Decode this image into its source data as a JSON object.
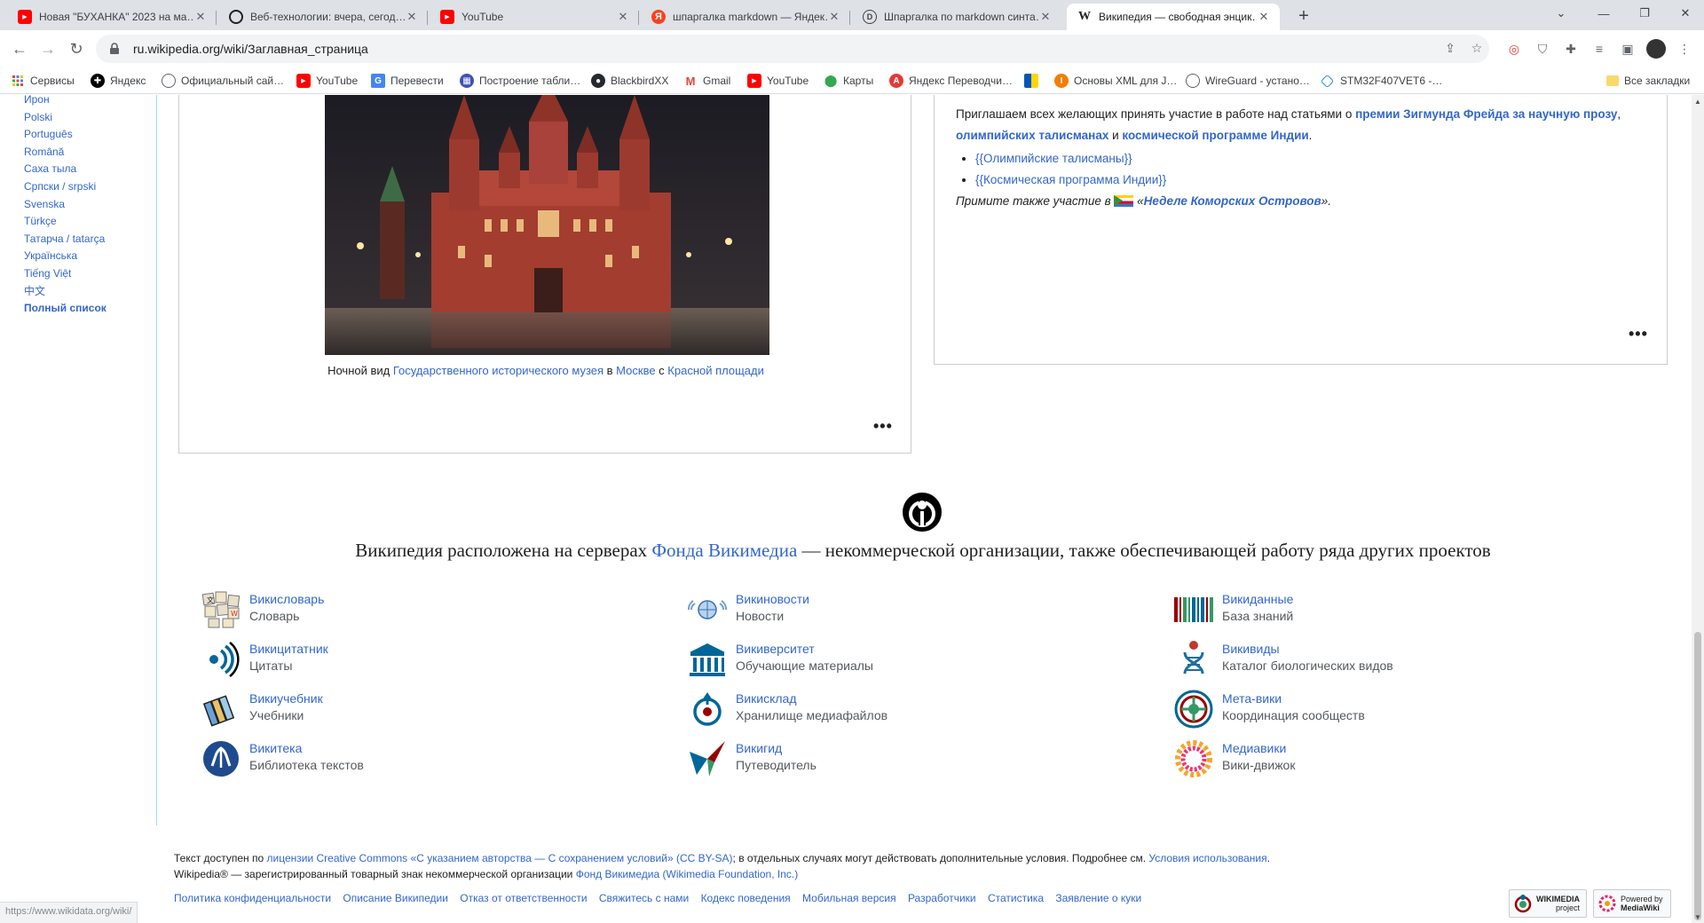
{
  "browser": {
    "tabs": [
      {
        "title": "Новая \"БУХАНКА\" 2023 на ма…",
        "favicon": "youtube-icon",
        "color": "#ff0000"
      },
      {
        "title": "Веб-технологии: вчера, сегод…",
        "favicon": "openai-icon",
        "color": "#202124"
      },
      {
        "title": "YouTube",
        "favicon": "youtube-icon",
        "color": "#ff0000"
      },
      {
        "title": "шпаргалка markdown — Яндек…",
        "favicon": "yandex-icon",
        "color": "#fc3f1d"
      },
      {
        "title": "Шпаргалка по markdown синта…",
        "favicon": "document-icon",
        "color": "#3c4043"
      },
      {
        "title": "Википедия — свободная энцик…",
        "favicon": "wikipedia-icon",
        "color": "#202124"
      }
    ],
    "url": "ru.wikipedia.org/wiki/Заглавная_страница",
    "bookmarks": [
      {
        "label": "Сервисы",
        "icon": "apps-grid-icon"
      },
      {
        "label": "Яндекс",
        "icon": "yandex-icon"
      },
      {
        "label": "Официальный сай…",
        "icon": "globe-icon"
      },
      {
        "label": "YouTube",
        "icon": "youtube-icon"
      },
      {
        "label": "Перевести",
        "icon": "translate-icon"
      },
      {
        "label": "Построение табли…",
        "icon": "table-icon"
      },
      {
        "label": "BlackbirdXX",
        "icon": "github-icon"
      },
      {
        "label": "Gmail",
        "icon": "gmail-icon"
      },
      {
        "label": "YouTube",
        "icon": "youtube-icon"
      },
      {
        "label": "Карты",
        "icon": "maps-icon"
      },
      {
        "label": "Яндекс Переводчи…",
        "icon": "yandex-translate-icon"
      },
      {
        "label": "",
        "icon": "flag-icon"
      },
      {
        "label": "Основы XML для J…",
        "icon": "xml-icon"
      },
      {
        "label": "WireGuard - устано…",
        "icon": "globe-icon"
      },
      {
        "label": "STM32F407VET6 -…",
        "icon": "chip-icon"
      }
    ],
    "all_bookmarks": "Все закладки",
    "status_url": "https://www.wikidata.org/wiki/"
  },
  "languages": [
    "Ирон",
    "Polski",
    "Português",
    "Română",
    "Саха тыла",
    "Српски / srpski",
    "Svenska",
    "Türkçe",
    "Татарча / tatarça",
    "Українська",
    "Tiếng Việt",
    "中文"
  ],
  "languages_full": "Полный список",
  "image_caption": {
    "pre": "Ночной вид ",
    "l1": "Государственного исторического музея",
    "mid1": " в ",
    "l2": "Москве",
    "mid2": " с ",
    "l3": "Красной площади"
  },
  "invite": {
    "t1": "Приглашаем всех желающих принять участие в работе над статьями о ",
    "l1": "премии Зигмунда Фрейда за научную прозу",
    "t2": ", ",
    "l2": "олимпийских талисманах",
    "t3": " и ",
    "l3": "космической программе Индии",
    "t4": ".",
    "items": [
      {
        "open": "{{",
        "link": "Олимпийские талисманы",
        "close": "}}"
      },
      {
        "open": "{{",
        "link": "Космическая программа Индии",
        "close": "}}"
      }
    ],
    "also_pre": "Примите также участие в ",
    "also_open": " «",
    "also_link": "Неделе Коморских Островов",
    "also_close": "»."
  },
  "more": "•••",
  "wikimedia": {
    "pre": "Википедия расположена на серверах ",
    "link": "Фонда Викимедиа",
    "post": " — некоммерческой организации, также обеспечивающей работу ряда других проектов"
  },
  "sisters": [
    {
      "name": "Викисловарь",
      "desc": "Словарь",
      "icon": "wiktionary-icon"
    },
    {
      "name": "Викиновости",
      "desc": "Новости",
      "icon": "wikinews-icon"
    },
    {
      "name": "Викиданные",
      "desc": "База знаний",
      "icon": "wikidata-icon"
    },
    {
      "name": "Викицитатник",
      "desc": "Цитаты",
      "icon": "wikiquote-icon"
    },
    {
      "name": "Викиверситет",
      "desc": "Обучающие материалы",
      "icon": "wikiversity-icon"
    },
    {
      "name": "Викивиды",
      "desc": "Каталог биологических видов",
      "icon": "wikispecies-icon"
    },
    {
      "name": "Викиучебник",
      "desc": "Учебники",
      "icon": "wikibooks-icon"
    },
    {
      "name": "Викисклад",
      "desc": "Хранилище медиафайлов",
      "icon": "commons-icon"
    },
    {
      "name": "Мета-вики",
      "desc": "Координация сообществ",
      "icon": "meta-icon"
    },
    {
      "name": "Викитека",
      "desc": "Библиотека текстов",
      "icon": "wikisource-icon"
    },
    {
      "name": "Викигид",
      "desc": "Путеводитель",
      "icon": "wikivoyage-icon"
    },
    {
      "name": "Медиавики",
      "desc": "Вики-движок",
      "icon": "mediawiki-icon"
    }
  ],
  "footer": {
    "line1_pre": "Текст доступен по ",
    "line1_link": "лицензии Creative Commons «С указанием авторства — С сохранением условий» (CC BY-SA)",
    "line1_mid": "; в отдельных случаях могут действовать дополнительные условия. Подробнее см. ",
    "line1_link2": "Условия использования",
    "line1_end": ".",
    "line2_pre": "Wikipedia® — зарегистрированный товарный знак некоммерческой организации ",
    "line2_link": "Фонд Викимедиа (Wikimedia Foundation, Inc.)",
    "links": [
      "Политика конфиденциальности",
      "Описание Википедии",
      "Отказ от ответственности",
      "Свяжитесь с нами",
      "Кодекс поведения",
      "Мобильная версия",
      "Разработчики",
      "Статистика",
      "Заявление о куки"
    ],
    "badge1": [
      "WIKIMEDIA",
      "project"
    ],
    "badge2": [
      "Powered by",
      "MediaWiki"
    ]
  }
}
